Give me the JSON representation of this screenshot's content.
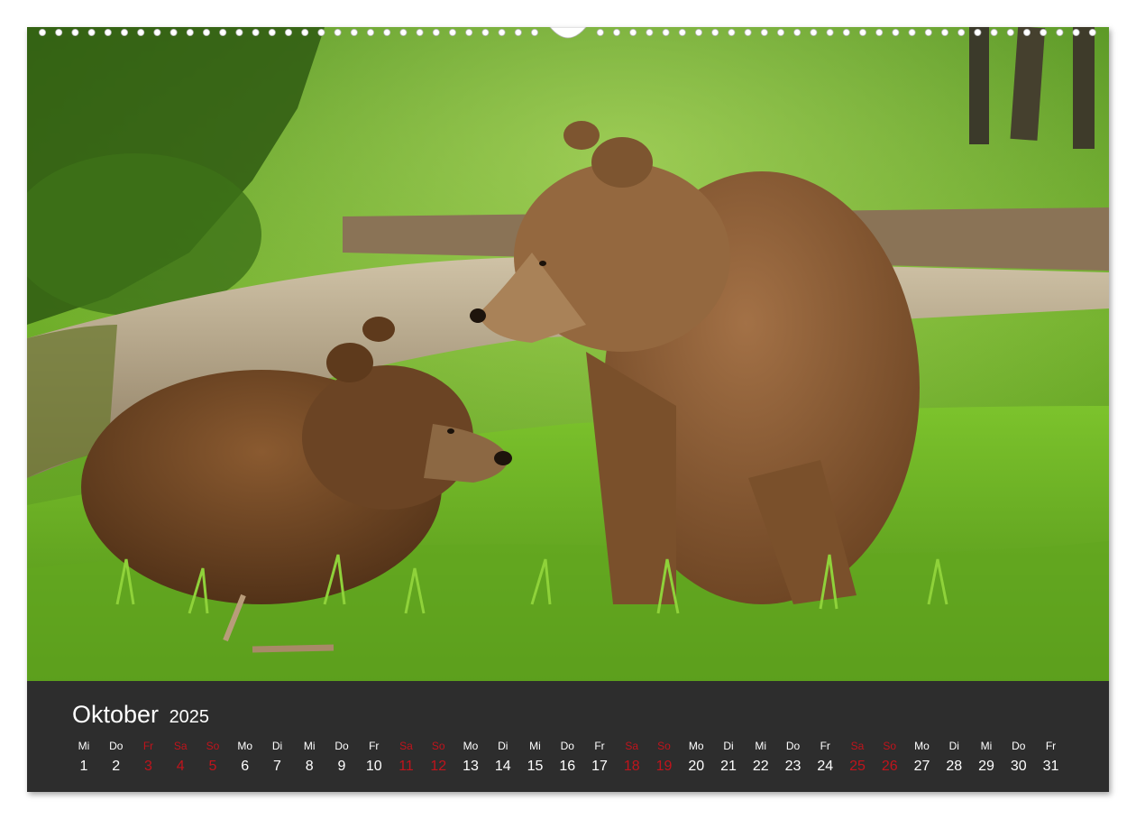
{
  "calendar": {
    "month": "Oktober",
    "year": "2025",
    "days": [
      {
        "wd": "Mi",
        "d": "1",
        "we": false
      },
      {
        "wd": "Do",
        "d": "2",
        "we": false
      },
      {
        "wd": "Fr",
        "d": "3",
        "we": true
      },
      {
        "wd": "Sa",
        "d": "4",
        "we": true
      },
      {
        "wd": "So",
        "d": "5",
        "we": true
      },
      {
        "wd": "Mo",
        "d": "6",
        "we": false
      },
      {
        "wd": "Di",
        "d": "7",
        "we": false
      },
      {
        "wd": "Mi",
        "d": "8",
        "we": false
      },
      {
        "wd": "Do",
        "d": "9",
        "we": false
      },
      {
        "wd": "Fr",
        "d": "10",
        "we": false
      },
      {
        "wd": "Sa",
        "d": "11",
        "we": true
      },
      {
        "wd": "So",
        "d": "12",
        "we": true
      },
      {
        "wd": "Mo",
        "d": "13",
        "we": false
      },
      {
        "wd": "Di",
        "d": "14",
        "we": false
      },
      {
        "wd": "Mi",
        "d": "15",
        "we": false
      },
      {
        "wd": "Do",
        "d": "16",
        "we": false
      },
      {
        "wd": "Fr",
        "d": "17",
        "we": false
      },
      {
        "wd": "Sa",
        "d": "18",
        "we": true
      },
      {
        "wd": "So",
        "d": "19",
        "we": true
      },
      {
        "wd": "Mo",
        "d": "20",
        "we": false
      },
      {
        "wd": "Di",
        "d": "21",
        "we": false
      },
      {
        "wd": "Mi",
        "d": "22",
        "we": false
      },
      {
        "wd": "Do",
        "d": "23",
        "we": false
      },
      {
        "wd": "Fr",
        "d": "24",
        "we": false
      },
      {
        "wd": "Sa",
        "d": "25",
        "we": true
      },
      {
        "wd": "So",
        "d": "26",
        "we": true
      },
      {
        "wd": "Mo",
        "d": "27",
        "we": false
      },
      {
        "wd": "Di",
        "d": "28",
        "we": false
      },
      {
        "wd": "Mi",
        "d": "29",
        "we": false
      },
      {
        "wd": "Do",
        "d": "30",
        "we": false
      },
      {
        "wd": "Fr",
        "d": "31",
        "we": false
      }
    ]
  },
  "colors": {
    "weekend": "#c0141c",
    "panel": "#2d2d2d"
  }
}
